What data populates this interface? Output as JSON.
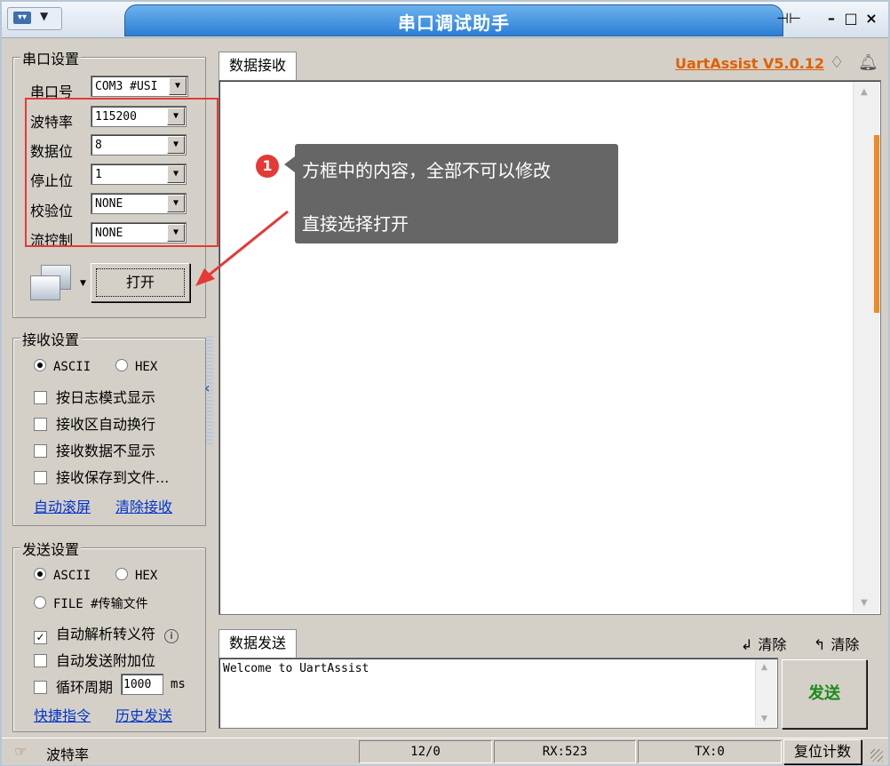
{
  "title": "串口调试助手",
  "version_link": "UartAssist V5.0.12",
  "serial_settings": {
    "title": "串口设置",
    "port_label": "串口号",
    "port_value": "COM3 #USI",
    "baud_label": "波特率",
    "baud_value": "115200",
    "databits_label": "数据位",
    "databits_value": "8",
    "stopbits_label": "停止位",
    "stopbits_value": "1",
    "parity_label": "校验位",
    "parity_value": "NONE",
    "flow_label": "流控制",
    "flow_value": "NONE",
    "open_button": "打开"
  },
  "receive_settings": {
    "title": "接收设置",
    "ascii": "ASCII",
    "hex": "HEX",
    "opt1": "按日志模式显示",
    "opt2": "接收区自动换行",
    "opt3": "接收数据不显示",
    "opt4": "接收保存到文件...",
    "link_autoscroll": "自动滚屏",
    "link_clear": "清除接收"
  },
  "send_settings": {
    "title": "发送设置",
    "ascii": "ASCII",
    "hex": "HEX",
    "file": "FILE #传输文件",
    "opt_escape": "自动解析转义符",
    "opt_append": "自动发送附加位",
    "opt_cycle": "循环周期",
    "cycle_value": "1000",
    "cycle_unit": "ms",
    "link_shortcut": "快捷指令",
    "link_history": "历史发送"
  },
  "receive_tab": "数据接收",
  "send_tab": "数据发送",
  "send_clear1": "清除",
  "send_clear2": "清除",
  "send_text": "Welcome to UartAssist",
  "send_button": "发送",
  "annotation": {
    "number": "1",
    "line1": "方框中的内容，全部不可以修改",
    "line2": "直接选择打开"
  },
  "status": {
    "hint": "波特率",
    "counter": "12/0",
    "rx": "RX:523",
    "tx": "TX:0",
    "reset": "复位计数"
  }
}
